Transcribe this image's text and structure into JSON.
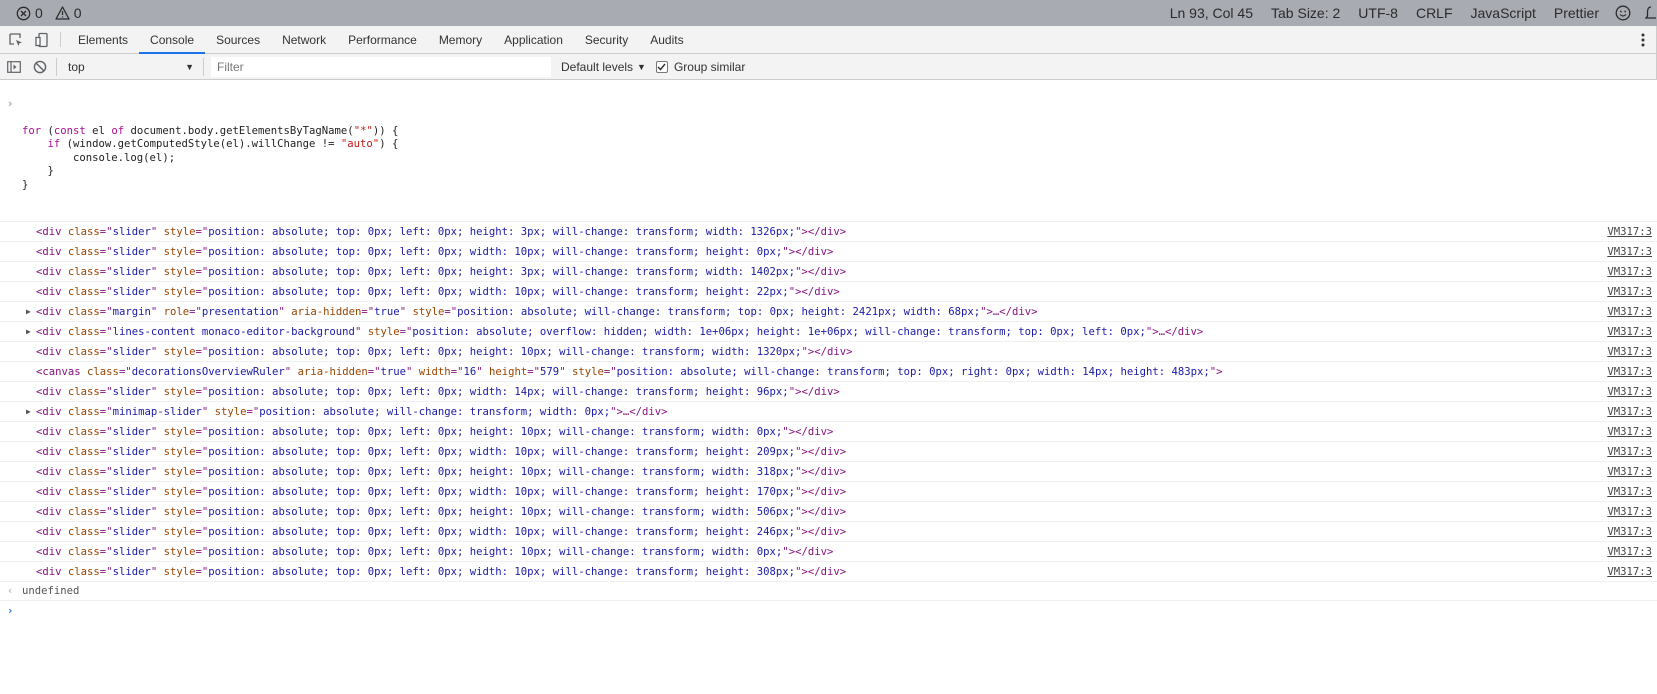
{
  "status_bar": {
    "errors": "0",
    "warnings": "0",
    "position": "Ln 93, Col 45",
    "tab_size": "Tab Size: 2",
    "encoding": "UTF-8",
    "line_ending": "CRLF",
    "language": "JavaScript",
    "formatter": "Prettier",
    "icons": [
      "error-icon",
      "warning-icon",
      "smiley-feedback-icon",
      "bell-icon"
    ]
  },
  "devtools": {
    "tabs": [
      "Elements",
      "Console",
      "Sources",
      "Network",
      "Performance",
      "Memory",
      "Application",
      "Security",
      "Audits"
    ],
    "active_tab": "Console",
    "icons": [
      "inspect-element-icon",
      "device-toolbar-icon",
      "more-menu-icon"
    ]
  },
  "console_toolbar": {
    "context": "top",
    "filter_placeholder": "Filter",
    "filter_value": "",
    "levels": "Default levels",
    "group_similar": "Group similar",
    "group_similar_checked": true,
    "icons": [
      "sidebar-toggle-icon",
      "clear-console-icon",
      "dropdown-arrow-icon"
    ]
  },
  "console": {
    "command_lines": [
      "for (const el of document.body.getElementsByTagName(\"*\")) {",
      "    if (window.getComputedStyle(el).willChange != \"auto\") {",
      "        console.log(el);",
      "    }",
      "}"
    ],
    "source_link": "VM317:3",
    "rows": [
      {
        "tag": "div",
        "attrs": [
          [
            "class",
            "slider"
          ],
          [
            "style",
            "position: absolute; top: 0px; left: 0px; height: 3px; will-change: transform; width: 1326px;"
          ]
        ],
        "expandable": false,
        "ellipsis": false
      },
      {
        "tag": "div",
        "attrs": [
          [
            "class",
            "slider"
          ],
          [
            "style",
            "position: absolute; top: 0px; left: 0px; width: 10px; will-change: transform; height: 0px;"
          ]
        ],
        "expandable": false,
        "ellipsis": false
      },
      {
        "tag": "div",
        "attrs": [
          [
            "class",
            "slider"
          ],
          [
            "style",
            "position: absolute; top: 0px; left: 0px; height: 3px; will-change: transform; width: 1402px;"
          ]
        ],
        "expandable": false,
        "ellipsis": false
      },
      {
        "tag": "div",
        "attrs": [
          [
            "class",
            "slider"
          ],
          [
            "style",
            "position: absolute; top: 0px; left: 0px; width: 10px; will-change: transform; height: 22px;"
          ]
        ],
        "expandable": false,
        "ellipsis": false
      },
      {
        "tag": "div",
        "attrs": [
          [
            "class",
            "margin"
          ],
          [
            "role",
            "presentation"
          ],
          [
            "aria-hidden",
            "true"
          ],
          [
            "style",
            "position: absolute; will-change: transform; top: 0px; height: 2421px; width: 68px;"
          ]
        ],
        "expandable": true,
        "ellipsis": true
      },
      {
        "tag": "div",
        "attrs": [
          [
            "class",
            "lines-content monaco-editor-background"
          ],
          [
            "style",
            "position: absolute; overflow: hidden; width: 1e+06px; height: 1e+06px; will-change: transform; top: 0px; left: 0px;"
          ]
        ],
        "expandable": true,
        "ellipsis": true
      },
      {
        "tag": "div",
        "attrs": [
          [
            "class",
            "slider"
          ],
          [
            "style",
            "position: absolute; top: 0px; left: 0px; height: 10px; will-change: transform; width: 1320px;"
          ]
        ],
        "expandable": false,
        "ellipsis": false
      },
      {
        "tag": "canvas",
        "attrs": [
          [
            "class",
            "decorationsOverviewRuler"
          ],
          [
            "aria-hidden",
            "true"
          ],
          [
            "width",
            "16"
          ],
          [
            "height",
            "579"
          ],
          [
            "style",
            "position: absolute; will-change: transform; top: 0px; right: 0px; width: 14px; height: 483px;"
          ]
        ],
        "expandable": false,
        "ellipsis": false,
        "selfclose": true
      },
      {
        "tag": "div",
        "attrs": [
          [
            "class",
            "slider"
          ],
          [
            "style",
            "position: absolute; top: 0px; left: 0px; width: 14px; will-change: transform; height: 96px;"
          ]
        ],
        "expandable": false,
        "ellipsis": false
      },
      {
        "tag": "div",
        "attrs": [
          [
            "class",
            "minimap-slider"
          ],
          [
            "style",
            "position: absolute; will-change: transform; width: 0px;"
          ]
        ],
        "expandable": true,
        "ellipsis": true
      },
      {
        "tag": "div",
        "attrs": [
          [
            "class",
            "slider"
          ],
          [
            "style",
            "position: absolute; top: 0px; left: 0px; height: 10px; will-change: transform; width: 0px;"
          ]
        ],
        "expandable": false,
        "ellipsis": false
      },
      {
        "tag": "div",
        "attrs": [
          [
            "class",
            "slider"
          ],
          [
            "style",
            "position: absolute; top: 0px; left: 0px; width: 10px; will-change: transform; height: 209px;"
          ]
        ],
        "expandable": false,
        "ellipsis": false
      },
      {
        "tag": "div",
        "attrs": [
          [
            "class",
            "slider"
          ],
          [
            "style",
            "position: absolute; top: 0px; left: 0px; height: 10px; will-change: transform; width: 318px;"
          ]
        ],
        "expandable": false,
        "ellipsis": false
      },
      {
        "tag": "div",
        "attrs": [
          [
            "class",
            "slider"
          ],
          [
            "style",
            "position: absolute; top: 0px; left: 0px; width: 10px; will-change: transform; height: 170px;"
          ]
        ],
        "expandable": false,
        "ellipsis": false
      },
      {
        "tag": "div",
        "attrs": [
          [
            "class",
            "slider"
          ],
          [
            "style",
            "position: absolute; top: 0px; left: 0px; height: 10px; will-change: transform; width: 506px;"
          ]
        ],
        "expandable": false,
        "ellipsis": false
      },
      {
        "tag": "div",
        "attrs": [
          [
            "class",
            "slider"
          ],
          [
            "style",
            "position: absolute; top: 0px; left: 0px; width: 10px; will-change: transform; height: 246px;"
          ]
        ],
        "expandable": false,
        "ellipsis": false
      },
      {
        "tag": "div",
        "attrs": [
          [
            "class",
            "slider"
          ],
          [
            "style",
            "position: absolute; top: 0px; left: 0px; height: 10px; will-change: transform; width: 0px;"
          ]
        ],
        "expandable": false,
        "ellipsis": false
      },
      {
        "tag": "div",
        "attrs": [
          [
            "class",
            "slider"
          ],
          [
            "style",
            "position: absolute; top: 0px; left: 0px; width: 10px; will-change: transform; height: 308px;"
          ]
        ],
        "expandable": false,
        "ellipsis": false
      }
    ],
    "result": "undefined",
    "colors": {
      "tag": "#881280",
      "attr_name": "#994500",
      "attr_value": "#1a1aa6",
      "keyword": "#aa0d91",
      "string": "#c41a16",
      "active_tab_underline": "#1a73e8",
      "status_bar_bg": "#a9abb3"
    }
  }
}
